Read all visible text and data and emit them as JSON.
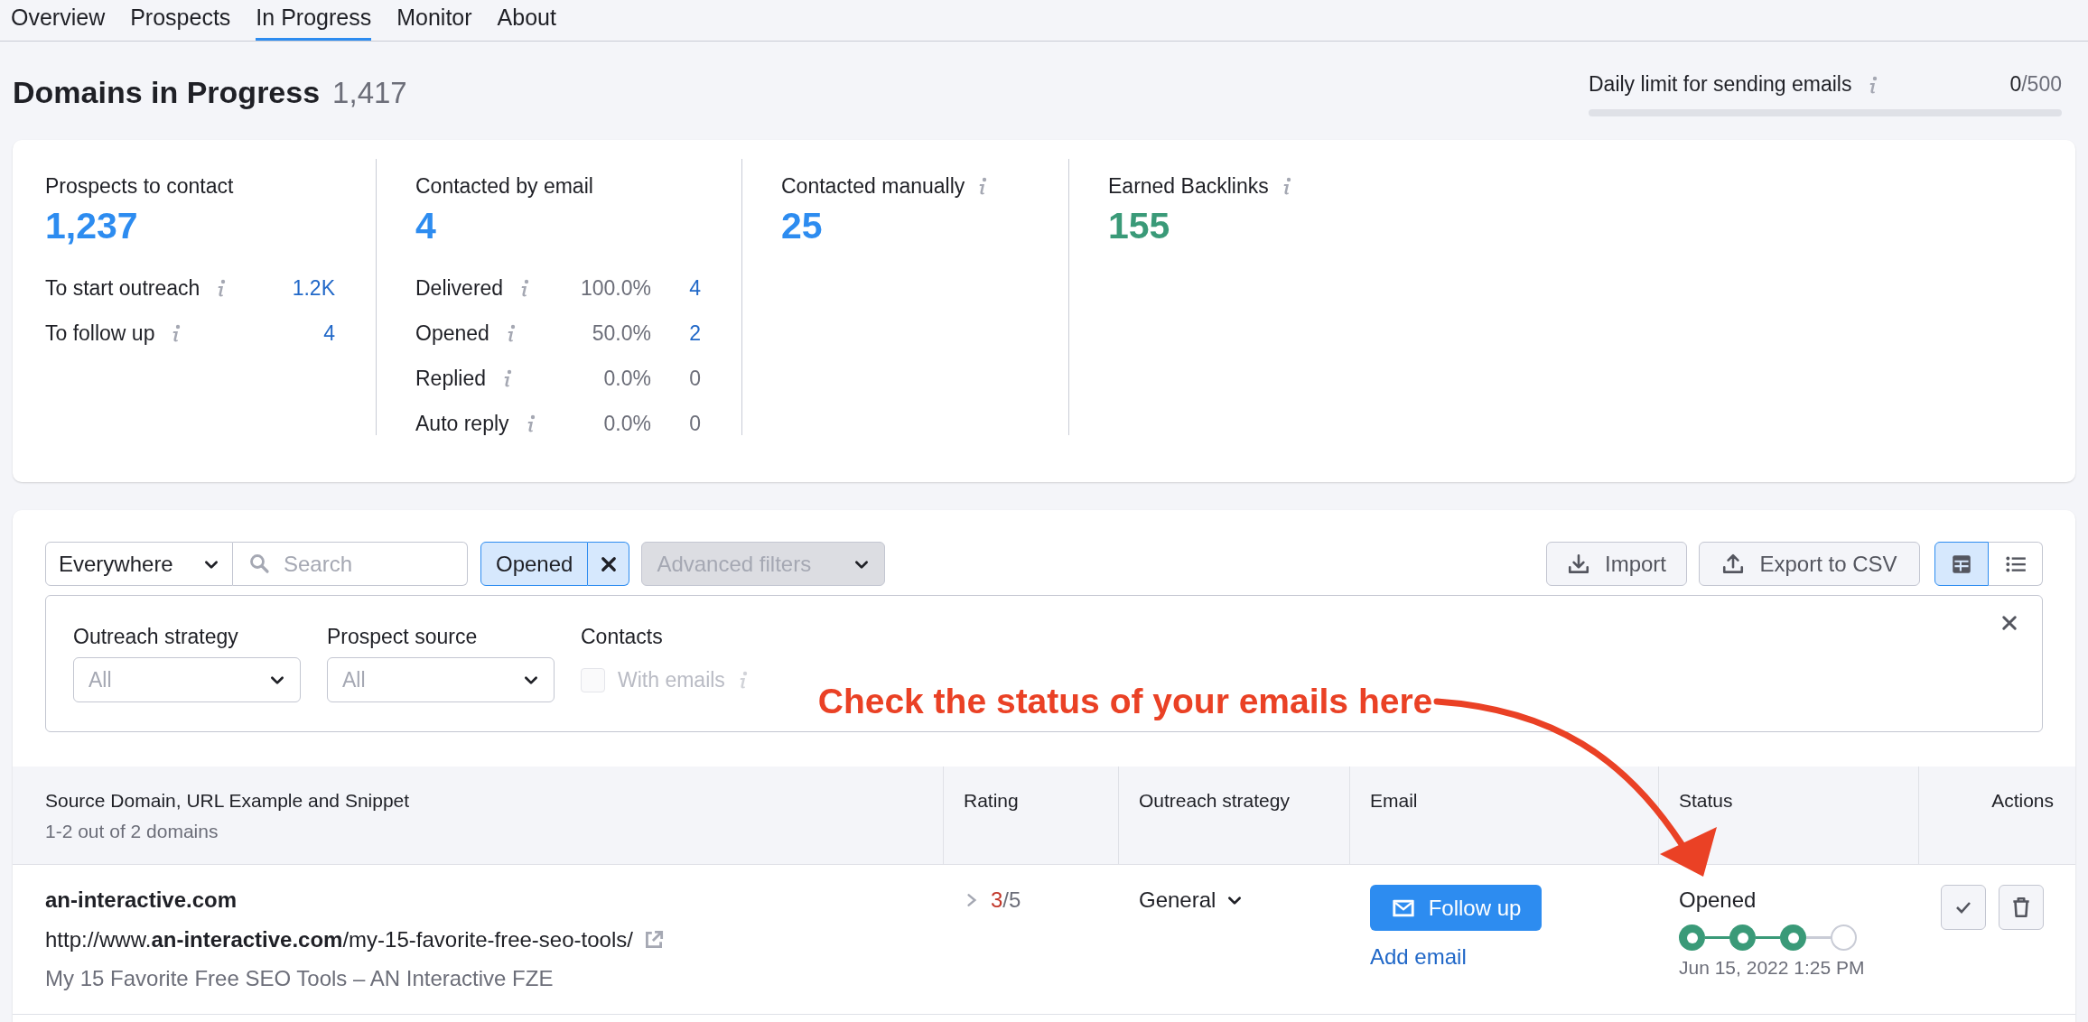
{
  "tabs": [
    {
      "label": "Overview",
      "selected": false
    },
    {
      "label": "Prospects",
      "selected": false
    },
    {
      "label": "In Progress",
      "selected": true
    },
    {
      "label": "Monitor",
      "selected": false
    },
    {
      "label": "About",
      "selected": false
    }
  ],
  "header": {
    "title": "Domains in Progress",
    "count": "1,417",
    "daily_limit": {
      "label": "Daily limit for sending emails",
      "used": "0",
      "total": "/500",
      "level": 0
    }
  },
  "stats": [
    {
      "title": "Prospects to contact",
      "info": false,
      "value": "1,237",
      "color": "#2d8cf0",
      "rows": [
        {
          "label": "To start outreach",
          "percent": null,
          "count": "1.2K",
          "link": true
        },
        {
          "label": "To follow up",
          "percent": null,
          "count": "4",
          "link": true
        }
      ]
    },
    {
      "title": "Contacted by email",
      "info": false,
      "value": "4",
      "color": "#2d8cf0",
      "rows": [
        {
          "label": "Delivered",
          "percent": "100.0%",
          "count": "4",
          "link": true
        },
        {
          "label": "Opened",
          "percent": "50.0%",
          "count": "2",
          "link": true
        },
        {
          "label": "Replied",
          "percent": "0.0%",
          "count": "0",
          "link": false
        },
        {
          "label": "Auto reply",
          "percent": "0.0%",
          "count": "0",
          "link": false
        }
      ]
    },
    {
      "title": "Contacted manually",
      "info": true,
      "value": "25",
      "color": "#2d8cf0"
    },
    {
      "title": "Earned Backlinks",
      "info": true,
      "value": "155",
      "color": "#3a9a78"
    }
  ],
  "filters": {
    "scope": "Everywhere",
    "search_placeholder": "Search",
    "chip": "Opened",
    "advanced": {
      "label": "Advanced filters",
      "expanded": true
    },
    "import": "Import",
    "export": "Export to CSV",
    "views": [
      {
        "kind": "table",
        "selected": true
      },
      {
        "kind": "list",
        "selected": false
      }
    ]
  },
  "panel": {
    "selects": [
      {
        "label": "Outreach strategy",
        "value": "All"
      },
      {
        "label": "Prospect source",
        "value": "All"
      }
    ],
    "contacts": {
      "label": "Contacts",
      "option": "With emails",
      "checked": false,
      "disabled": true
    }
  },
  "annotation": {
    "text": "Check the status of your emails here"
  },
  "table": {
    "columns": [
      {
        "label": "Source Domain, URL Example and Snippet",
        "sub": "1-2 out of 2 domains"
      },
      {
        "label": "Rating"
      },
      {
        "label": "Outreach strategy"
      },
      {
        "label": "Email"
      },
      {
        "label": "Status"
      },
      {
        "label": "Actions"
      }
    ],
    "rows": [
      {
        "domain": "an-interactive.com",
        "url": "http://www.**an-interactive.com**/my-15-favorite-free-seo-tools/",
        "snippet": "My 15 Favorite Free SEO Tools – AN Interactive FZE",
        "rating": "3",
        "rating_max": "/5",
        "strategy": "General",
        "email_button": "Follow up",
        "email_link": "Add email",
        "status": "Opened",
        "steps": [
          {
            "done": true
          },
          {
            "done": true
          },
          {
            "done": true
          },
          {
            "done": false
          }
        ],
        "date": "Jun 15, 2022 1:25 PM"
      }
    ]
  }
}
